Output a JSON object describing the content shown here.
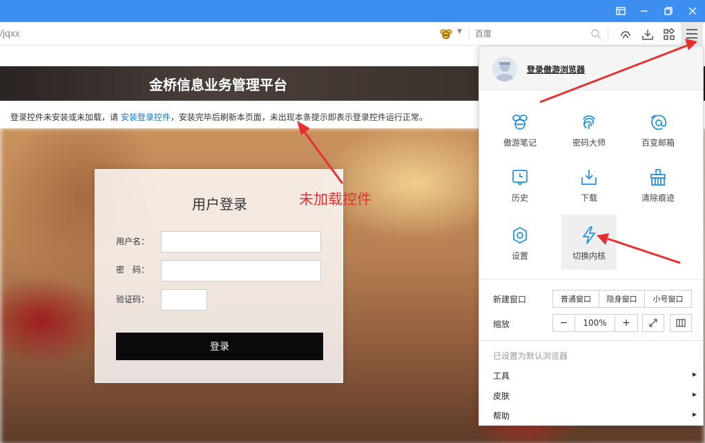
{
  "browser": {
    "url": "/jqxx",
    "search_placeholder": "百度"
  },
  "page": {
    "platform_title": "金桥信息业务管理平台",
    "notice_prefix": "登录控件未安装或未加载，请 ",
    "notice_link": "安装登录控件",
    "notice_suffix": "，安装完毕后刷新本页面，未出现本条提示即表示登录控件运行正常。",
    "login": {
      "title": "用户登录",
      "username_label": "用户名：",
      "password_label": "密　码：",
      "captcha_label": "验证码：",
      "submit_label": "登录"
    },
    "annotation": "未加载控件"
  },
  "menu": {
    "login_link": "登录傲游浏览器",
    "grid": [
      {
        "label": "傲游笔记",
        "icon": "bee-note-icon"
      },
      {
        "label": "密码大师",
        "icon": "fingerprint-icon"
      },
      {
        "label": "百变邮箱",
        "icon": "at-mail-icon"
      },
      {
        "label": "历史",
        "icon": "history-icon"
      },
      {
        "label": "下载",
        "icon": "download-icon"
      },
      {
        "label": "清除痕迹",
        "icon": "broom-icon"
      },
      {
        "label": "设置",
        "icon": "settings-gear-icon"
      },
      {
        "label": "切换内核",
        "icon": "lightning-icon"
      }
    ],
    "new_window": {
      "label": "新建窗口",
      "options": [
        "普通窗口",
        "隐身窗口",
        "小号窗口"
      ]
    },
    "zoom": {
      "label": "缩放",
      "minus": "−",
      "value": "100%",
      "plus": "+"
    },
    "default_note": "已设置为默认浏览器",
    "submenus": [
      "工具",
      "皮肤",
      "帮助"
    ]
  },
  "colors": {
    "titlebar": "#3c8ef0",
    "accent_blue": "#1f8ee0",
    "annotation_red": "#e53030"
  }
}
